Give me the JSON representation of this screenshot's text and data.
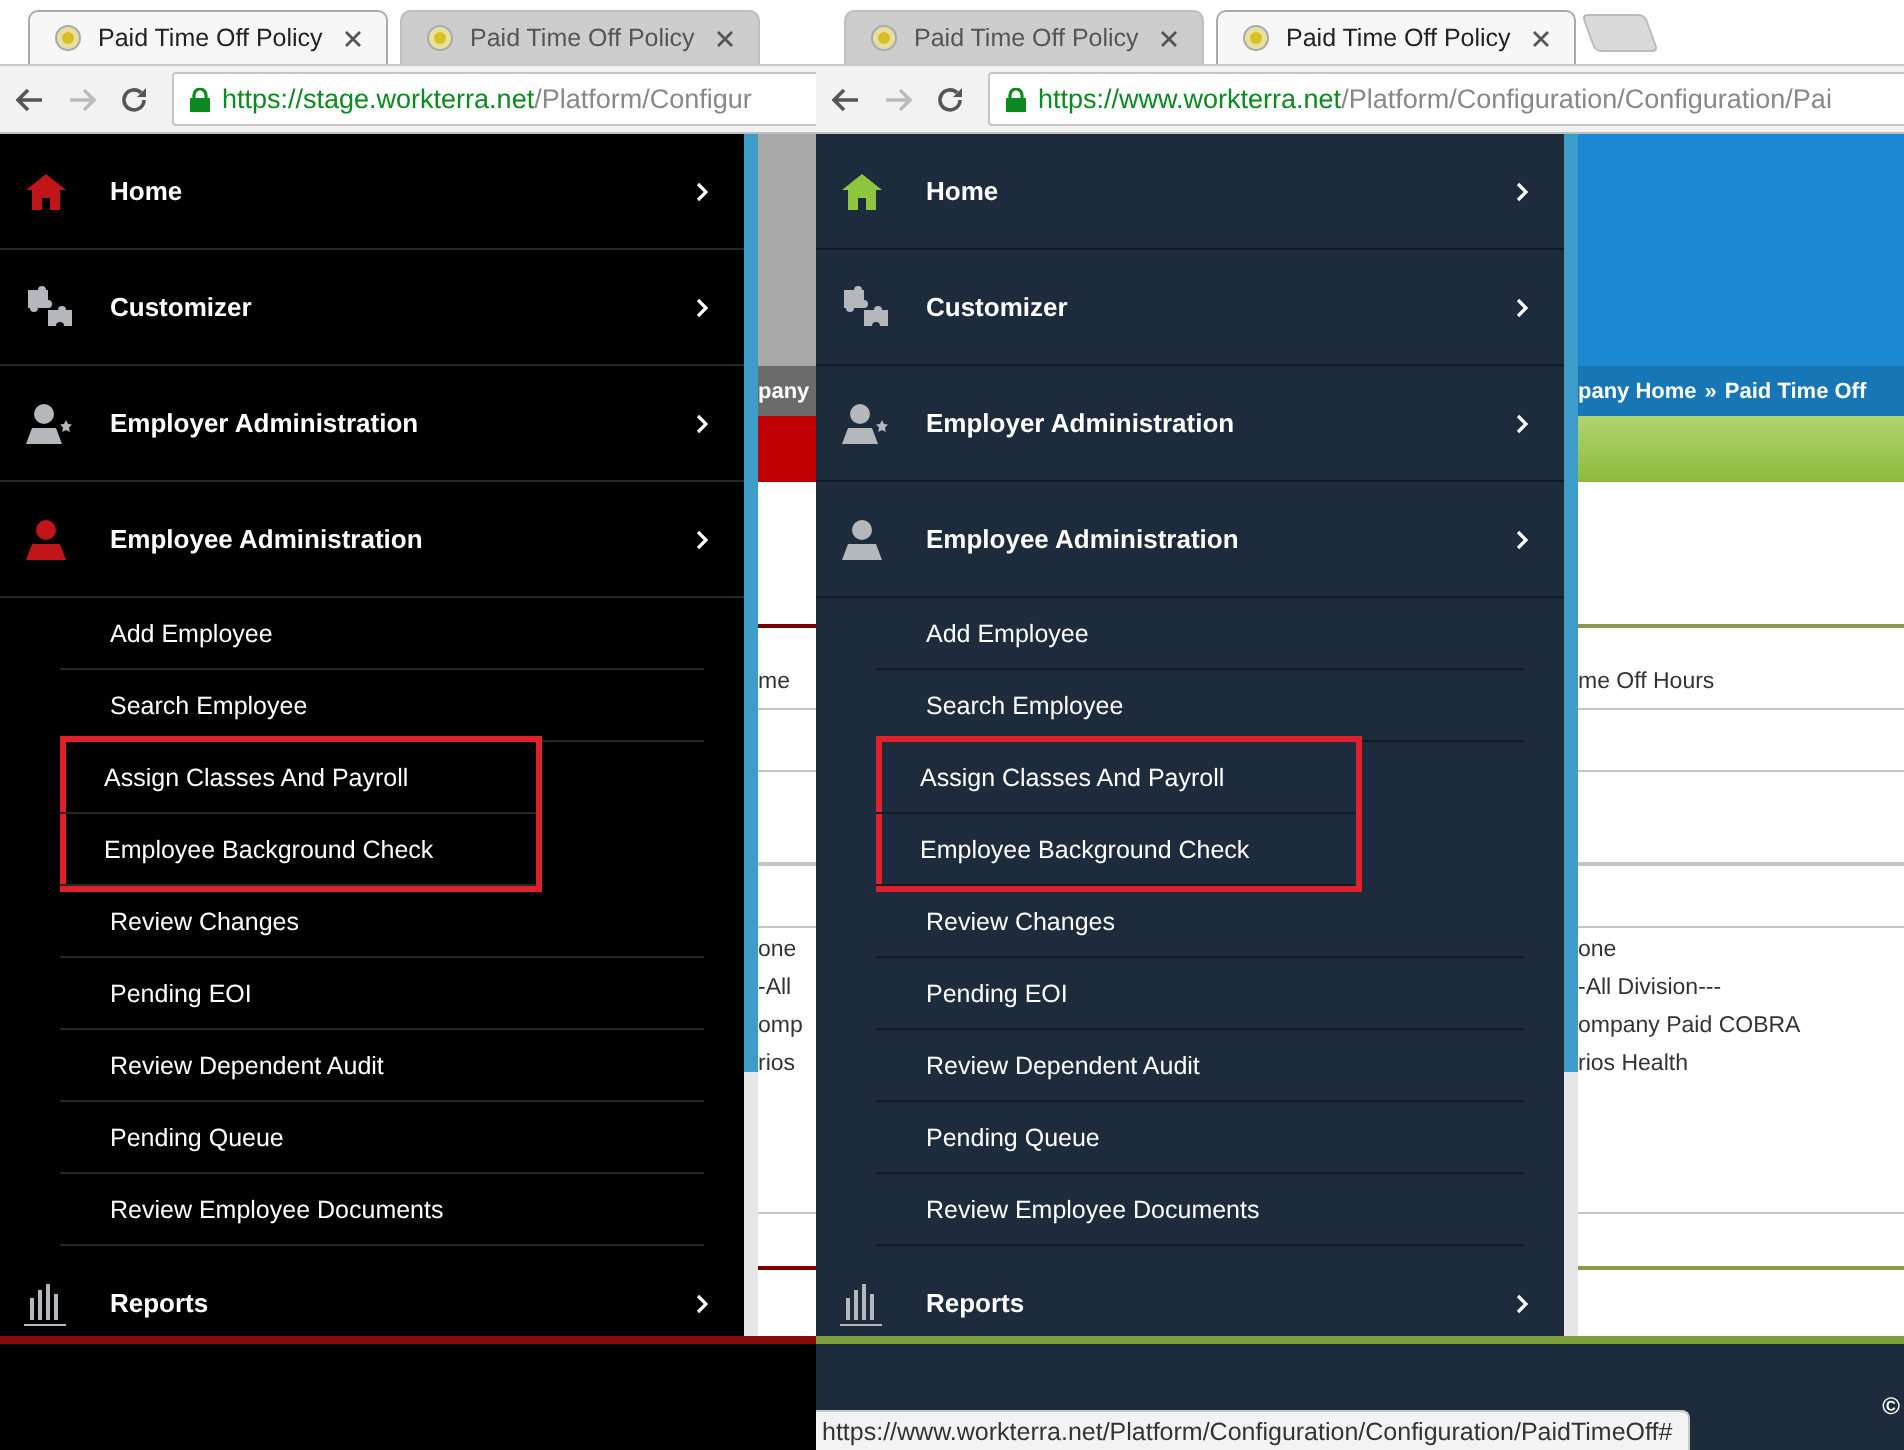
{
  "panes": [
    {
      "kind": "classic",
      "tabs": [
        {
          "title": "Paid Time Off Policy",
          "selected": true
        },
        {
          "title": "Paid Time Off Policy",
          "selected": false
        }
      ],
      "url_host": "https://stage.workterra.net",
      "url_path": "/Platform/Configur",
      "menu": [
        {
          "label": "Home",
          "highlighted": true
        },
        {
          "label": "Customizer",
          "highlighted": false
        },
        {
          "label": "Employer Administration",
          "highlighted": false
        },
        {
          "label": "Employee Administration",
          "highlighted": true,
          "children": [
            {
              "label": "Add Employee",
              "annotated": false
            },
            {
              "label": "Search Employee",
              "annotated": false
            },
            {
              "label": "Assign Classes And Payroll",
              "annotated": true
            },
            {
              "label": "Employee Background Check",
              "annotated": true
            },
            {
              "label": "Review Changes",
              "annotated": false
            },
            {
              "label": "Pending EOI",
              "annotated": false
            },
            {
              "label": "Review Dependent Audit",
              "annotated": false
            },
            {
              "label": "Pending Queue",
              "annotated": false
            },
            {
              "label": "Review Employee Documents",
              "annotated": false
            }
          ]
        },
        {
          "label": "Reports",
          "highlighted": false
        }
      ],
      "content": {
        "breadcrumb": [
          "pany"
        ],
        "field_label": "me",
        "list": [
          "one",
          "-All",
          "omp",
          "rios"
        ]
      }
    },
    {
      "kind": "modern",
      "tabs": [
        {
          "title": "Paid Time Off Policy",
          "selected": false
        },
        {
          "title": "Paid Time Off Policy",
          "selected": true
        }
      ],
      "new_tab": true,
      "url_host": "https://www.workterra.net",
      "url_path": "/Platform/Configuration/Configuration/Pai",
      "menu": [
        {
          "label": "Home",
          "highlighted": true
        },
        {
          "label": "Customizer",
          "highlighted": false
        },
        {
          "label": "Employer Administration",
          "highlighted": false
        },
        {
          "label": "Employee Administration",
          "highlighted": false,
          "children": [
            {
              "label": "Add Employee",
              "annotated": false
            },
            {
              "label": "Search Employee",
              "annotated": false
            },
            {
              "label": "Assign Classes And Payroll",
              "annotated": true
            },
            {
              "label": "Employee Background Check",
              "annotated": true
            },
            {
              "label": "Review Changes",
              "annotated": false
            },
            {
              "label": "Pending EOI",
              "annotated": false
            },
            {
              "label": "Review Dependent Audit",
              "annotated": false
            },
            {
              "label": "Pending Queue",
              "annotated": false
            },
            {
              "label": "Review Employee Documents",
              "annotated": false
            }
          ]
        },
        {
          "label": "Reports",
          "highlighted": false
        }
      ],
      "content": {
        "breadcrumb": [
          "pany Home",
          "»",
          "Paid Time Off"
        ],
        "field_label": "me Off Hours",
        "list": [
          "one",
          "-All Division---",
          "ompany Paid COBRA",
          "rios Health"
        ]
      },
      "footer_text": "©",
      "status_url": "https://www.workterra.net/Platform/Configuration/Configuration/PaidTimeOff#"
    }
  ]
}
